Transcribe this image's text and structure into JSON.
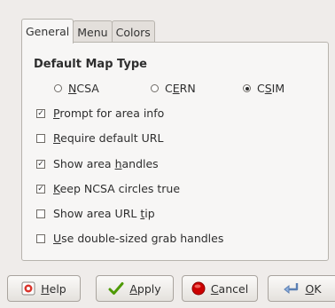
{
  "tabs": [
    {
      "label": "General",
      "active": true
    },
    {
      "label": "Menu",
      "active": false
    },
    {
      "label": "Colors",
      "active": false
    }
  ],
  "section": {
    "title": "Default Map Type"
  },
  "map_types": [
    {
      "prefix": "",
      "accel": "N",
      "suffix": "CSA",
      "selected": false
    },
    {
      "prefix": "C",
      "accel": "E",
      "suffix": "RN",
      "selected": false
    },
    {
      "prefix": "C",
      "accel": "S",
      "suffix": "IM",
      "selected": true
    }
  ],
  "options": [
    {
      "prefix": "",
      "accel": "P",
      "suffix": "rompt for area info",
      "checked": true
    },
    {
      "prefix": "",
      "accel": "R",
      "suffix": "equire default URL",
      "checked": false
    },
    {
      "prefix": "Show area ",
      "accel": "h",
      "suffix": "andles",
      "checked": true
    },
    {
      "prefix": "",
      "accel": "K",
      "suffix": "eep NCSA circles true",
      "checked": true
    },
    {
      "prefix": "Show area URL ",
      "accel": "t",
      "suffix": "ip",
      "checked": false
    },
    {
      "prefix": "",
      "accel": "U",
      "suffix": "se double-sized grab handles",
      "checked": false
    }
  ],
  "buttons": {
    "help": {
      "accel": "H",
      "rest": "elp",
      "icon": "help-icon"
    },
    "apply": {
      "accel": "A",
      "rest": "pply",
      "icon": "checkmark-icon"
    },
    "cancel": {
      "accel": "C",
      "rest": "ancel",
      "icon": "stop-icon"
    },
    "ok": {
      "accel": "O",
      "rest": "K",
      "icon": "return-arrow-icon"
    }
  },
  "check_mark": "✓"
}
